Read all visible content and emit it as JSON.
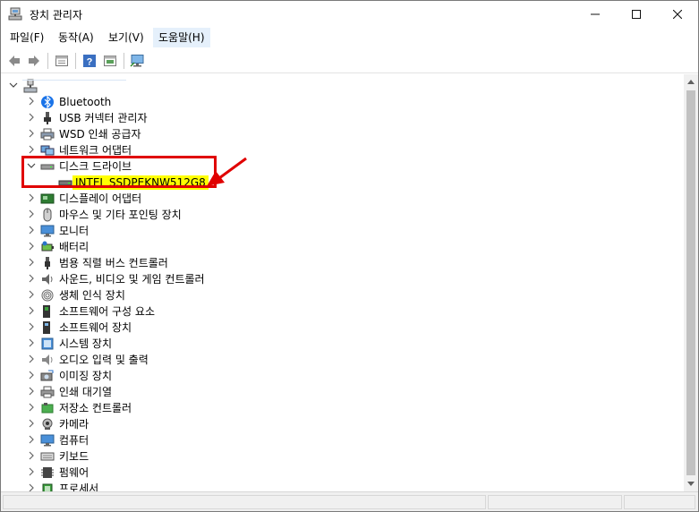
{
  "window": {
    "title": "장치 관리자",
    "controls": {
      "minimize": "—",
      "maximize": "☐",
      "close": "✕"
    }
  },
  "menu": [
    {
      "label": "파일(F)"
    },
    {
      "label": "동작(A)"
    },
    {
      "label": "보기(V)"
    },
    {
      "label": "도움말(H)"
    }
  ],
  "toolbar": {
    "icons": [
      "back-icon",
      "forward-icon",
      "properties-icon",
      "help-icon",
      "update-driver-icon",
      "monitor-scan-icon"
    ]
  },
  "tree": {
    "root_icon": "computer-icon",
    "items": [
      {
        "label": "Bluetooth",
        "icon": "bluetooth-icon",
        "expanded": false
      },
      {
        "label": "USB 커넥터 관리자",
        "icon": "usb-icon",
        "expanded": false
      },
      {
        "label": "WSD 인쇄 공급자",
        "icon": "printer-icon",
        "expanded": false
      },
      {
        "label": "네트워크 어댑터",
        "icon": "network-icon",
        "expanded": false
      },
      {
        "label": "디스크 드라이브",
        "icon": "disk-drive-icon",
        "expanded": true
      },
      {
        "label": "INTEL SSDPEKNW512G8",
        "icon": "disk-icon",
        "child": true,
        "highlighted": true
      },
      {
        "label": "디스플레이 어댑터",
        "icon": "display-adapter-icon",
        "expanded": false
      },
      {
        "label": "마우스 및 기타 포인팅 장치",
        "icon": "mouse-icon",
        "expanded": false
      },
      {
        "label": "모니터",
        "icon": "monitor-icon",
        "expanded": false
      },
      {
        "label": "배터리",
        "icon": "battery-icon",
        "expanded": false
      },
      {
        "label": "범용 직렬 버스 컨트롤러",
        "icon": "usb-controller-icon",
        "expanded": false
      },
      {
        "label": "사운드, 비디오 및 게임 컨트롤러",
        "icon": "sound-icon",
        "expanded": false
      },
      {
        "label": "생체 인식 장치",
        "icon": "fingerprint-icon",
        "expanded": false
      },
      {
        "label": "소프트웨어 구성 요소",
        "icon": "software-component-icon",
        "expanded": false
      },
      {
        "label": "소프트웨어 장치",
        "icon": "software-device-icon",
        "expanded": false
      },
      {
        "label": "시스템 장치",
        "icon": "system-device-icon",
        "expanded": false
      },
      {
        "label": "오디오 입력 및 출력",
        "icon": "audio-icon",
        "expanded": false
      },
      {
        "label": "이미징 장치",
        "icon": "camera-imaging-icon",
        "expanded": false
      },
      {
        "label": "인쇄 대기열",
        "icon": "print-queue-icon",
        "expanded": false
      },
      {
        "label": "저장소 컨트롤러",
        "icon": "storage-controller-icon",
        "expanded": false
      },
      {
        "label": "카메라",
        "icon": "webcam-icon",
        "expanded": false
      },
      {
        "label": "컴퓨터",
        "icon": "computer-monitor-icon",
        "expanded": false
      },
      {
        "label": "키보드",
        "icon": "keyboard-icon",
        "expanded": false
      },
      {
        "label": "펌웨어",
        "icon": "firmware-icon",
        "expanded": false
      },
      {
        "label": "프로세서",
        "icon": "processor-icon",
        "expanded": false
      }
    ]
  },
  "colors": {
    "annotation": "#e00000",
    "highlight": "#ffff00",
    "menu_active": "#e5f0fb"
  }
}
